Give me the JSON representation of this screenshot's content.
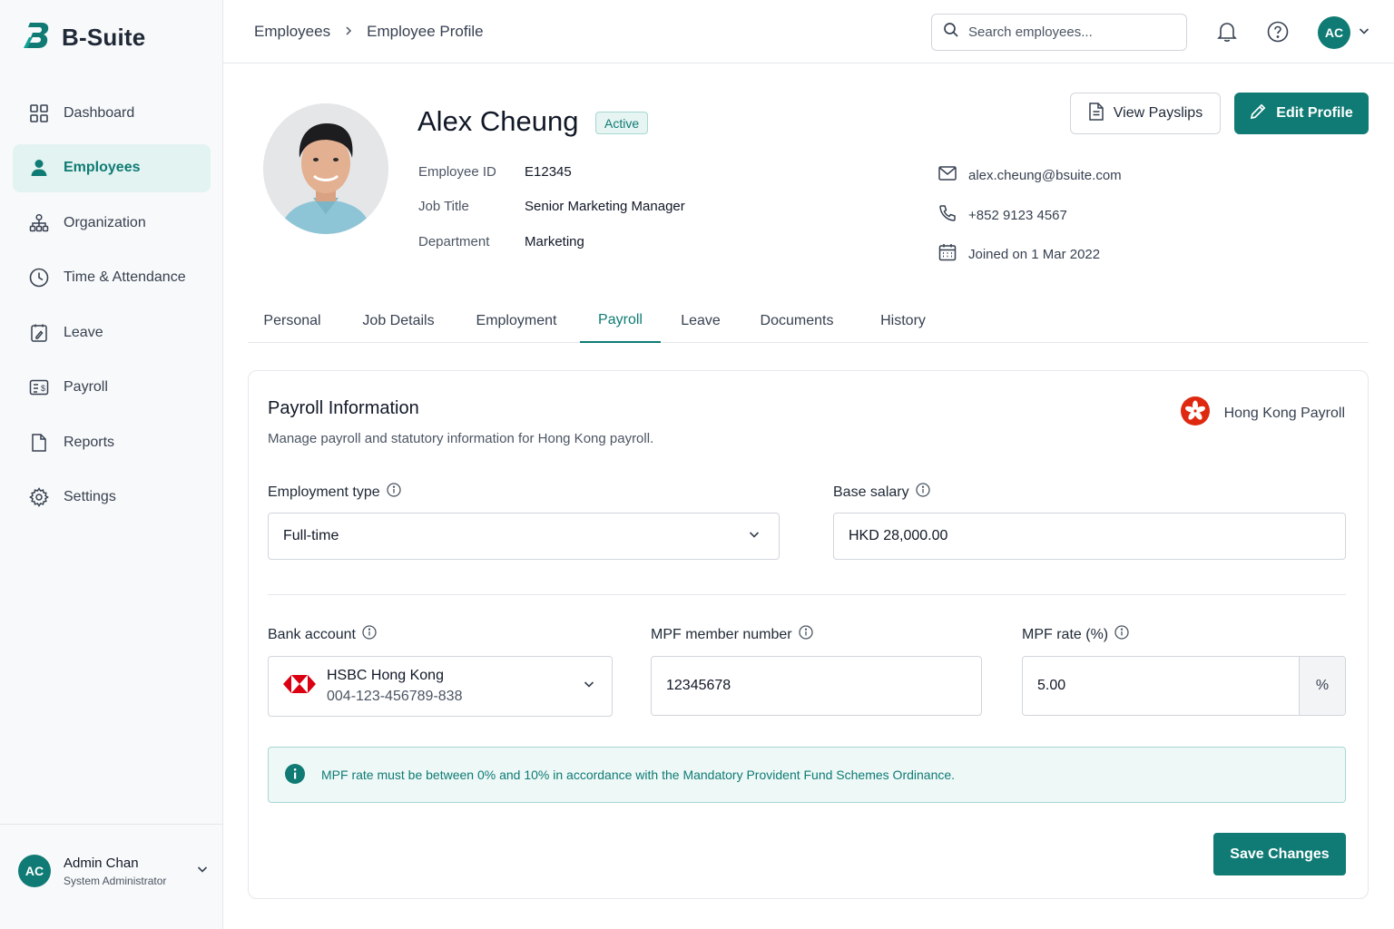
{
  "app": {
    "name": "B-Suite"
  },
  "sidebar": {
    "items": [
      {
        "label": "Dashboard",
        "icon": "grid-icon"
      },
      {
        "label": "Employees",
        "icon": "person-icon",
        "active": true
      },
      {
        "label": "Organization",
        "icon": "org-chart-icon"
      },
      {
        "label": "Time & Attendance",
        "icon": "clock-icon"
      },
      {
        "label": "Leave",
        "icon": "calendar-edit-icon"
      },
      {
        "label": "Payroll",
        "icon": "payroll-icon"
      },
      {
        "label": "Reports",
        "icon": "file-icon"
      },
      {
        "label": "Settings",
        "icon": "gear-icon"
      }
    ],
    "user": {
      "initials": "AC",
      "name": "Admin Chan",
      "role": "System Administrator"
    }
  },
  "header": {
    "breadcrumb": [
      "Employees",
      "Employee Profile"
    ],
    "search_placeholder": "Search employees...",
    "avatar_initials": "AC"
  },
  "profile": {
    "name": "Alex Cheung",
    "status": "Active",
    "fields": [
      {
        "label": "Employee ID",
        "value": "E12345"
      },
      {
        "label": "Job Title",
        "value": "Senior Marketing Manager"
      },
      {
        "label": "Department",
        "value": "Marketing"
      }
    ],
    "email": "alex.cheung@bsuite.com",
    "phone": "+852 9123 4567",
    "joined": "Joined on 1 Mar 2022",
    "view_payslips": "View Payslips",
    "edit_profile": "Edit Profile"
  },
  "tabs": [
    {
      "label": "Personal"
    },
    {
      "label": "Job Details"
    },
    {
      "label": "Employment"
    },
    {
      "label": "Payroll",
      "active": true
    },
    {
      "label": "Leave"
    },
    {
      "label": "Documents"
    },
    {
      "label": "History"
    }
  ],
  "payroll": {
    "title": "Payroll Information",
    "subtitle": "Manage payroll and statutory information for Hong Kong payroll.",
    "region_label": "Hong Kong Payroll",
    "employment_type": {
      "label": "Employment type",
      "value": "Full-time"
    },
    "base_salary": {
      "label": "Base salary",
      "value": "HKD 28,000.00"
    },
    "bank_account": {
      "label": "Bank account",
      "bank": "HSBC Hong Kong",
      "number": "004-123-456789-838"
    },
    "mpf_member": {
      "label": "MPF member number",
      "value": "12345678"
    },
    "mpf_rate": {
      "label": "MPF rate (%)",
      "value": "5.00",
      "suffix": "%"
    },
    "alert": "MPF rate must be between 0% and 10% in accordance with the Mandatory Provident Fund Schemes Ordinance.",
    "save_label": "Save Changes"
  },
  "colors": {
    "accent": "#0f7b74",
    "accent_light": "#e3f3f1",
    "hk_red": "#de2910",
    "hsbc_red": "#db0011"
  }
}
